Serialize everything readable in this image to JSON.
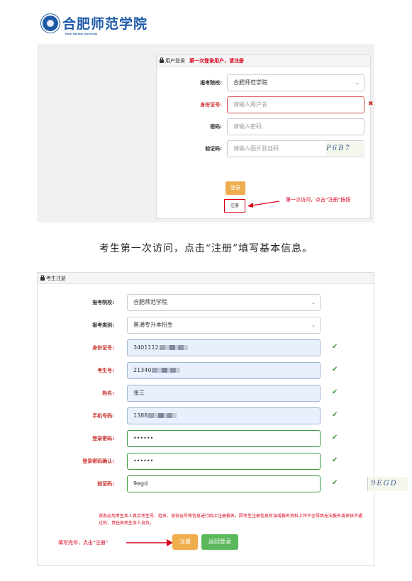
{
  "logo": {
    "name": "合肥师范学院",
    "en": "Hefei Normal University"
  },
  "login": {
    "title": "用户登录",
    "note": "第一次登录用户，请注册",
    "school_label": "报考院校:",
    "school_value": "合肥师范学院",
    "id_label": "身份证号:",
    "id_placeholder": "请输入用户名",
    "password_label": "密码:",
    "password_placeholder": "请输入密码",
    "captcha_label": "验证码:",
    "captcha_placeholder": "请输入图片验证码",
    "captcha_image_text": "P6B7",
    "login_button": "登录",
    "register_button": "注册",
    "callout": "第一次访问，点击“注册”按钮"
  },
  "caption": "考生第一次访问，点击“注册”填写基本信息。",
  "register": {
    "title": "考生注册",
    "fields": {
      "school_label": "报考院校:",
      "school_value": "合肥师范学院",
      "category_label": "报考类别:",
      "category_value": "普通专升本招生",
      "id_label": "身份证号:",
      "id_value": "3401112",
      "exam_no_label": "考生号:",
      "exam_no_value": "21340",
      "name_label": "姓名:",
      "name_value": "张三",
      "phone_label": "手机号码:",
      "phone_value": "1388",
      "password_label": "登录密码:",
      "password_value": "••••••",
      "confirm_label": "登录密码确认:",
      "confirm_value": "••••••",
      "captcha_label": "验证码:",
      "captcha_value": "9egd",
      "captcha_image_text": "9EGD"
    },
    "notice": "请务必用考生本人真实考生号、姓名、身份证号等信息进行网上注册报名，因考生注册信息有误或报名资料上传不全导致无法报名或审核不通过的，责任由考生本人自负。",
    "callout": "填写完毕，点击“注册”",
    "register_button": "注册",
    "back_button": "返回登录"
  },
  "colors": {
    "accent_red": "#d9001b",
    "warning_orange": "#f0ad4e",
    "success_green": "#5cb85c",
    "logo_blue": "#1d5aa8"
  }
}
